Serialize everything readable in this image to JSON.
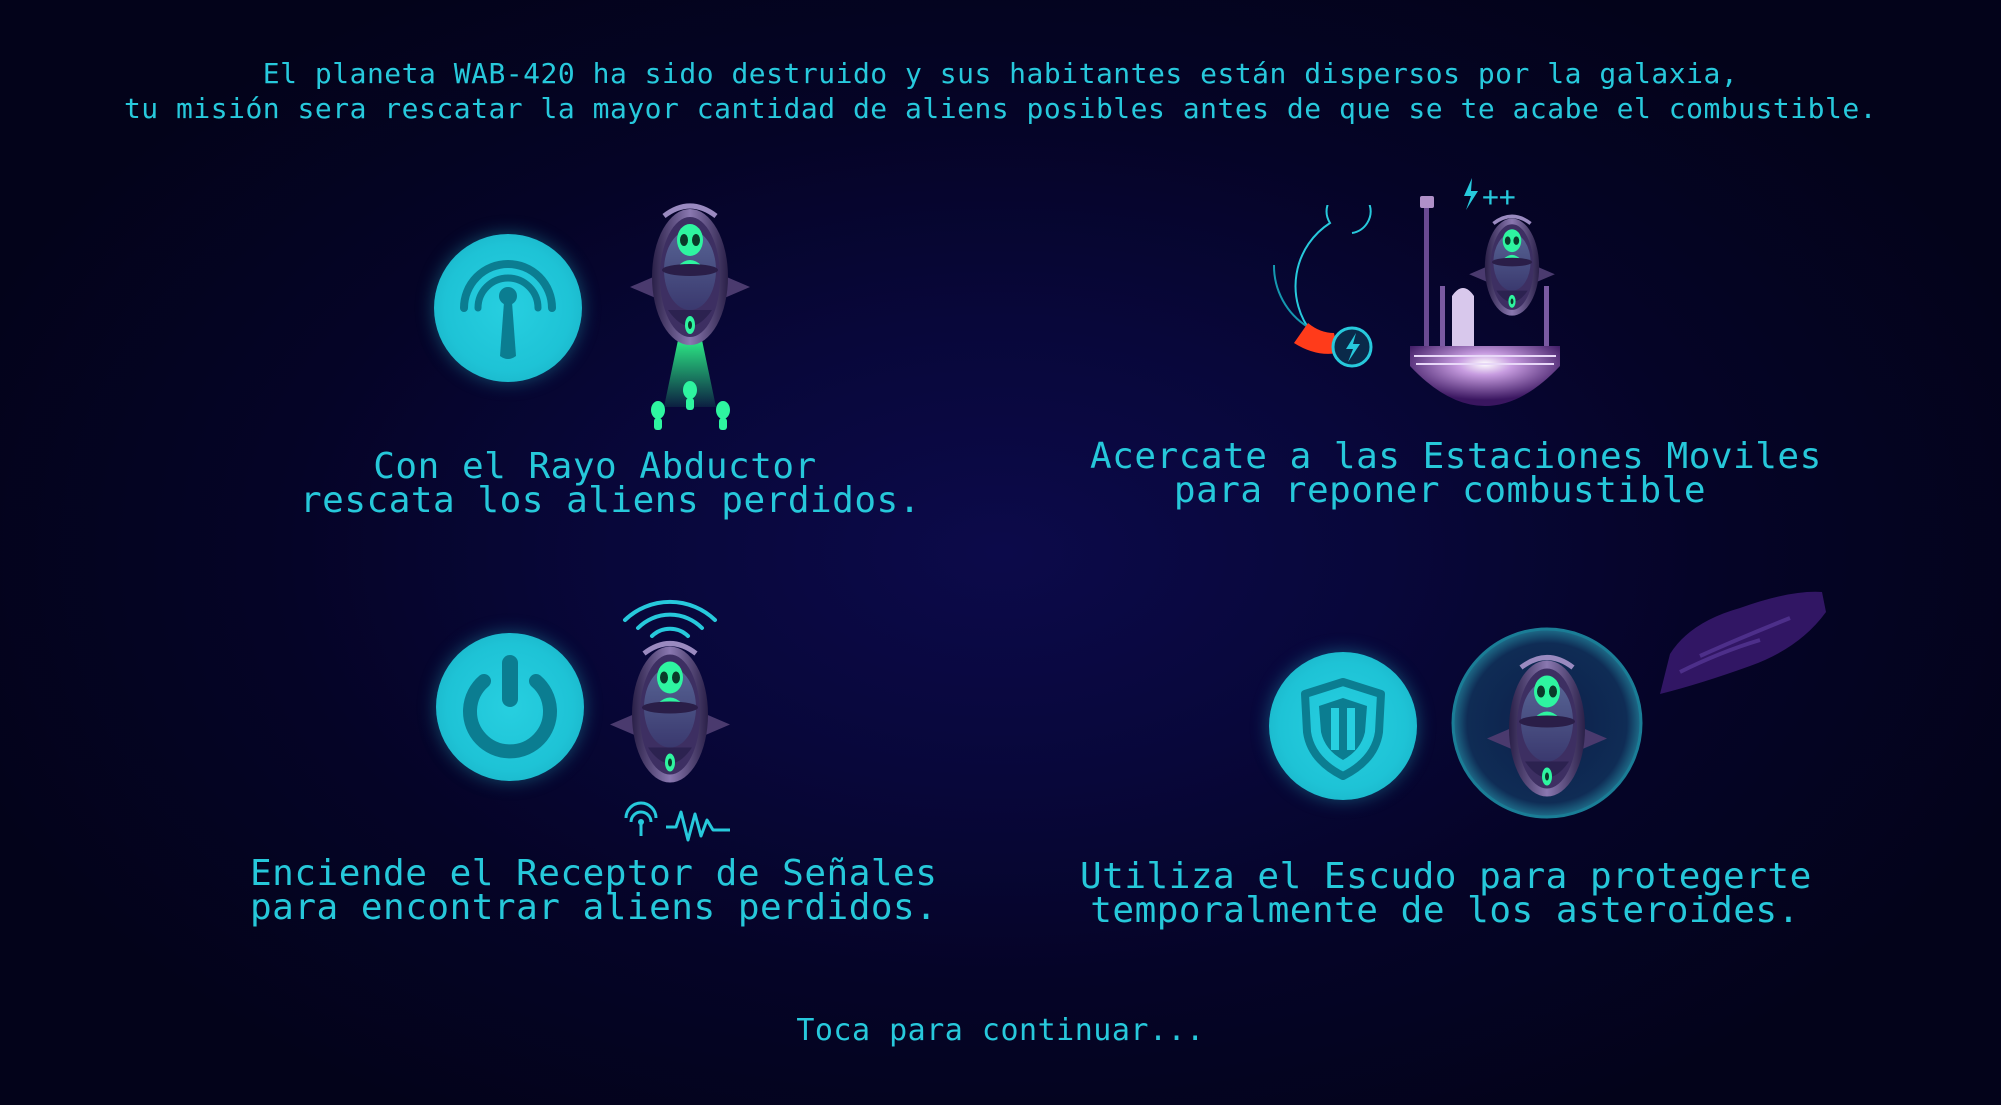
{
  "intro": {
    "line1": "El planeta WAB-420 ha sido destruido y sus habitantes están dispersos por la galaxia,",
    "line2": "tu misión sera rescatar la mayor cantidad de aliens posibles antes de que se te acabe el combustible."
  },
  "panels": {
    "abductor": {
      "icon": "antenna-icon",
      "line1": "Con el Rayo Abductor",
      "line2": "rescata los aliens perdidos."
    },
    "fuel": {
      "icon": "fuel-gauge-icon",
      "badge": "++",
      "line1": "Acercate a las Estaciones Moviles",
      "line2": "para reponer combustible"
    },
    "receiver": {
      "icon": "power-icon",
      "line1": "Enciende el Receptor de Señales",
      "line2": "para encontrar aliens perdidos."
    },
    "shield": {
      "icon": "shield-icon",
      "line1": "Utiliza el Escudo para protegerte",
      "line2": "temporalmente de los asteroides."
    }
  },
  "continue_label": "Toca para continuar...",
  "colors": {
    "accent": "#27c9dc",
    "alien": "#2ef5a0",
    "ship": "#6a5a8e",
    "fuel_low": "#ff3b1a",
    "background": "#08073a"
  }
}
